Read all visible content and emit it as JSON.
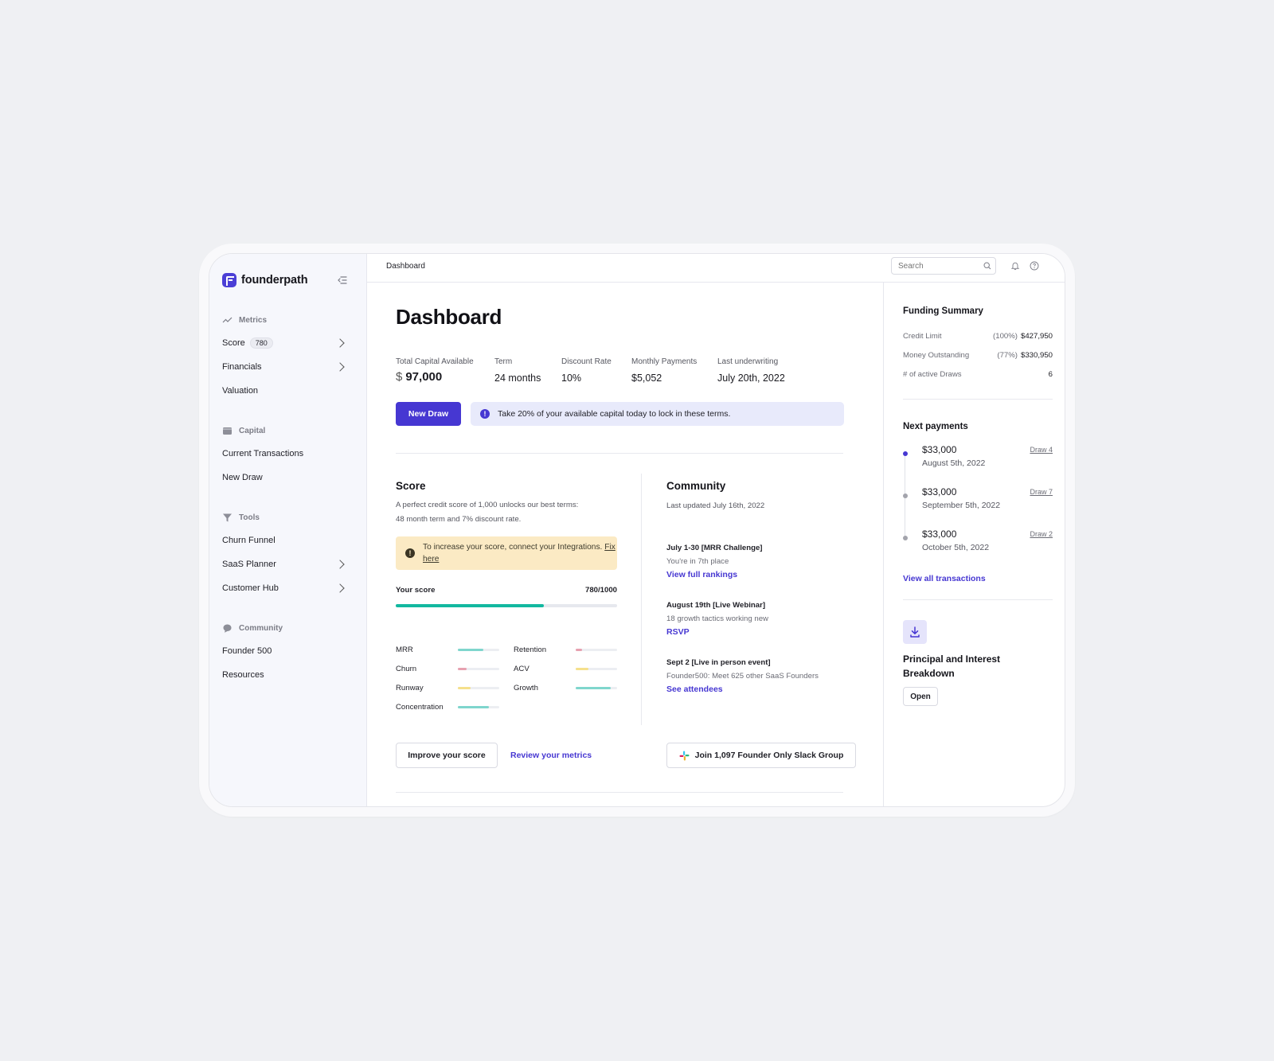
{
  "brand": {
    "name": "founderpath"
  },
  "sidebar": {
    "sections": [
      {
        "title": "Metrics",
        "items": [
          {
            "label": "Score",
            "badge": "780"
          },
          {
            "label": "Financials"
          },
          {
            "label": "Valuation"
          }
        ]
      },
      {
        "title": "Capital",
        "items": [
          {
            "label": "Current Transactions"
          },
          {
            "label": "New Draw"
          }
        ]
      },
      {
        "title": "Tools",
        "items": [
          {
            "label": "Churn Funnel"
          },
          {
            "label": "SaaS Planner"
          },
          {
            "label": "Customer Hub"
          }
        ]
      },
      {
        "title": "Community",
        "items": [
          {
            "label": "Founder 500"
          },
          {
            "label": "Resources"
          }
        ]
      }
    ]
  },
  "topbar": {
    "breadcrumb": "Dashboard",
    "search_placeholder": "Search"
  },
  "main": {
    "title": "Dashboard",
    "stats": {
      "capital_label": "Total Capital Available",
      "capital_currency": "$",
      "capital_value": "97,000",
      "term_label": "Term",
      "term_value": "24 months",
      "discount_label": "Discount Rate",
      "discount_value": "10%",
      "monthly_label": "Monthly Payments",
      "monthly_value": "$5,052",
      "underwriting_label": "Last underwriting",
      "underwriting_value": "July 20th, 2022"
    },
    "new_draw_button": "New Draw",
    "notice": "Take 20% of your available capital today to lock in these terms."
  },
  "score": {
    "title": "Score",
    "description": "A perfect credit score of 1,000 unlocks our best terms: 48 month term and 7% discount rate.",
    "warning_text": "To increase your score, connect your Integrations.",
    "warning_link": "Fix here",
    "your_score_label": "Your score",
    "your_score_value": "780/1000",
    "score_fraction": 0.67,
    "metrics": [
      {
        "label": "MRR",
        "level": 0.62,
        "color": "#7fd6cd"
      },
      {
        "label": "Retention",
        "level": 0.15,
        "color": "#e7a1b0"
      },
      {
        "label": "Churn",
        "level": 0.22,
        "color": "#e7a1b0"
      },
      {
        "label": "ACV",
        "level": 0.3,
        "color": "#f5e08c"
      },
      {
        "label": "Runway",
        "level": 0.3,
        "color": "#f5e08c"
      },
      {
        "label": "Growth",
        "level": 0.85,
        "color": "#7fd6cd"
      },
      {
        "label": "Concentration",
        "level": 0.75,
        "color": "#7fd6cd"
      }
    ],
    "improve_button": "Improve your score",
    "review_link": "Review your metrics"
  },
  "community": {
    "title": "Community",
    "updated": "Last updated July 16th, 2022",
    "events": [
      {
        "title": "July 1-30 [MRR Challenge]",
        "desc": "You're in 7th place",
        "link": "View full rankings"
      },
      {
        "title": "August 19th [Live Webinar]",
        "desc": "18 growth tactics working new",
        "link": "RSVP"
      },
      {
        "title": "Sept 2 [Live in person event]",
        "desc": "Founder500: Meet 625 other SaaS Founders",
        "link": "See attendees"
      }
    ],
    "slack_button": "Join 1,097 Founder Only Slack Group"
  },
  "funding": {
    "title": "Funding Summary",
    "credit_label": "Credit Limit",
    "credit_pct": "(100%)",
    "credit_value": "$427,950",
    "outstanding_label": "Money Outstanding",
    "outstanding_pct": "(77%)",
    "outstanding_value": "$330,950",
    "draws_label": "# of active Draws",
    "draws_value": "6"
  },
  "payments": {
    "title": "Next payments",
    "items": [
      {
        "amount": "$33,000",
        "date": "August 5th, 2022",
        "draw": "Draw 4"
      },
      {
        "amount": "$33,000",
        "date": "September 5th, 2022",
        "draw": "Draw 7"
      },
      {
        "amount": "$33,000",
        "date": "October 5th, 2022",
        "draw": "Draw 2"
      }
    ],
    "view_all": "View all transactions"
  },
  "breakdown": {
    "title": "Principal and Interest Breakdown",
    "open_button": "Open"
  },
  "colors": {
    "accent": "#4637d2",
    "score_fill": "#12b8a0",
    "warning_bg": "#fbeac4",
    "notice_bg": "#e8eafb"
  }
}
